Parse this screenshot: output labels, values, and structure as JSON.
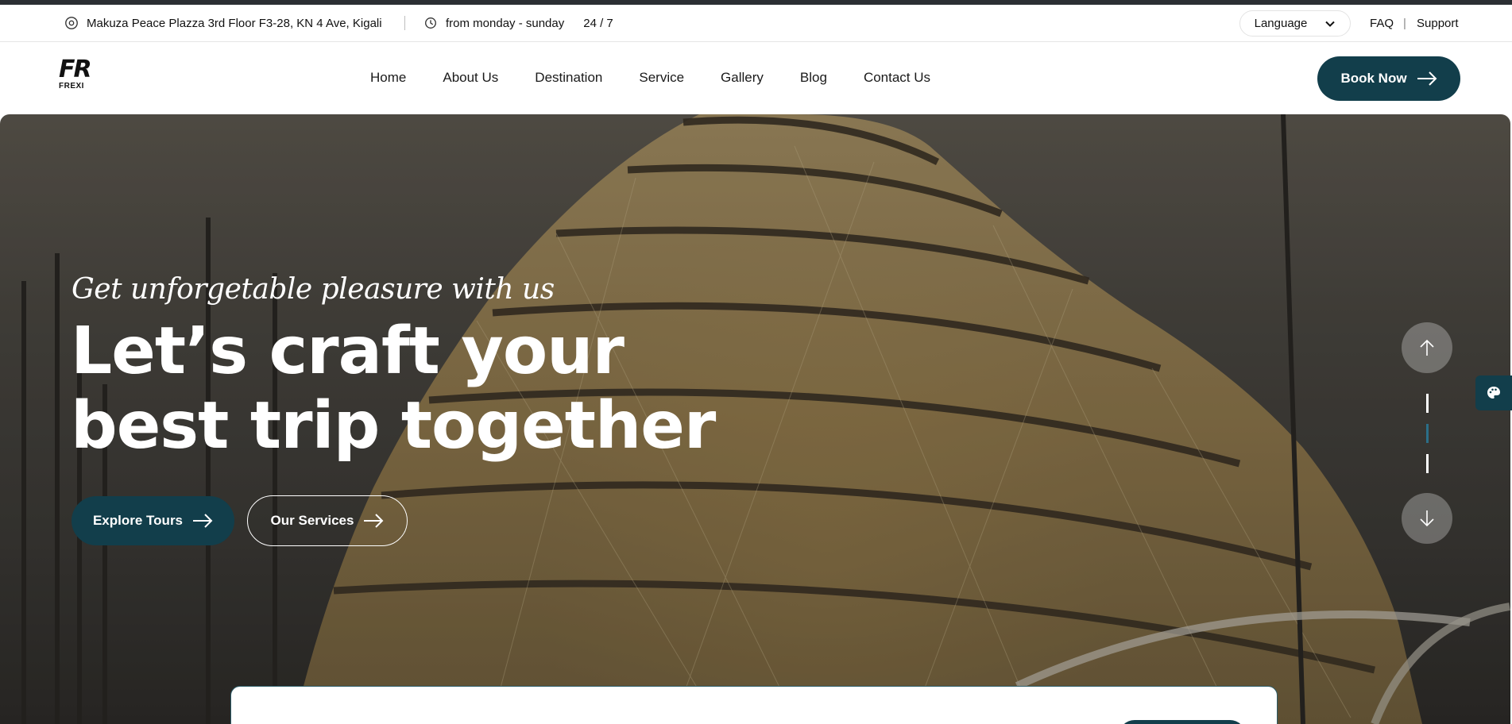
{
  "topbar": {
    "address": "Makuza Peace Plazza 3rd Floor F3-28, KN 4 Ave, Kigali",
    "hours": "from monday - sunday",
    "hours_247": "24 / 7",
    "language_label": "Language",
    "faq_label": "FAQ",
    "separator": "|",
    "support_label": "Support"
  },
  "brand": {
    "logo_mark": "FR",
    "logo_text": "FREXI"
  },
  "nav": {
    "items": [
      {
        "label": "Home"
      },
      {
        "label": "About Us"
      },
      {
        "label": "Destination"
      },
      {
        "label": "Service"
      },
      {
        "label": "Gallery"
      },
      {
        "label": "Blog"
      },
      {
        "label": "Contact Us"
      }
    ],
    "book_label": "Book Now"
  },
  "hero": {
    "tagline": "Get unforgetable pleasure with us",
    "headline_line1": "Let’s craft your",
    "headline_line2": "best trip together",
    "explore_label": "Explore Tours",
    "services_label": "Our Services"
  },
  "slider": {
    "count": 3,
    "active_index": 1
  },
  "colors": {
    "primary": "#123e4b",
    "accent": "#2b6f88",
    "topstrip": "#2b2f33"
  },
  "icons": {
    "location": "map-pin-icon",
    "clock": "clock-icon",
    "chevron": "chevron-down-icon",
    "arrow": "arrow-right-icon",
    "palette": "palette-icon"
  }
}
